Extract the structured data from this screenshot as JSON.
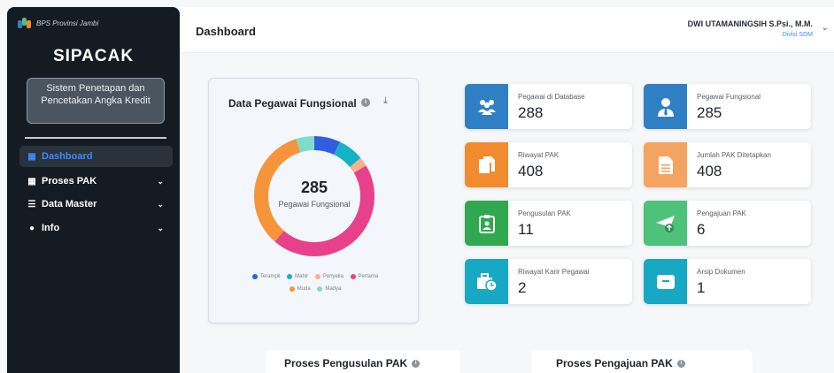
{
  "sidebar": {
    "brand": "BPS Provinsi Jambi",
    "app_title": "SIPACAK",
    "app_subtitle": "Sistem Penetapan dan Pencetakan Angka Kredit",
    "items": [
      {
        "label": "Dashboard",
        "icon": "grid-icon",
        "active": true
      },
      {
        "label": "Proses PAK",
        "icon": "grid-icon",
        "chevron": true
      },
      {
        "label": "Data Master",
        "icon": "database-icon",
        "chevron": true
      },
      {
        "label": "Info",
        "icon": "info-icon",
        "chevron": true
      }
    ]
  },
  "header": {
    "title": "Dashboard",
    "user_name": "DWI UTAMANINGSIH S.Psi., M.M.",
    "user_role": "Divisi SDM"
  },
  "donut_card": {
    "title": "Data Pegawai Fungsional",
    "center_value": "285",
    "center_label": "Pegawai Fungsional",
    "legend": [
      {
        "label": "Terampil",
        "color": "#2f5ee0"
      },
      {
        "label": "Mahir",
        "color": "#15b3c9"
      },
      {
        "label": "Penyelia",
        "color": "#f7b189"
      },
      {
        "label": "Pertama",
        "color": "#e8418c"
      },
      {
        "label": "Muda",
        "color": "#f6943a"
      },
      {
        "label": "Madya",
        "color": "#7fdcc8"
      }
    ]
  },
  "chart_data": {
    "type": "pie",
    "title": "Data Pegawai Fungsional",
    "categories": [
      "Terampil",
      "Mahir",
      "Penyelia",
      "Pertama",
      "Muda",
      "Madya"
    ],
    "values": [
      20,
      20,
      7,
      128,
      96,
      14
    ],
    "colors": [
      "#2f5ee0",
      "#15b3c9",
      "#f7b189",
      "#e8418c",
      "#f6943a",
      "#7fdcc8"
    ],
    "legend_position": "bottom"
  },
  "stats": [
    {
      "label": "Pegawai di Database",
      "value": "288",
      "color": "#2f7fc4",
      "icon": "users-icon"
    },
    {
      "label": "Pegawai Fungsional",
      "value": "285",
      "color": "#2f7fc4",
      "icon": "user-tie-icon"
    },
    {
      "label": "Riwayat PAK",
      "value": "408",
      "color": "#f28a2e",
      "icon": "copy-icon"
    },
    {
      "label": "Jumlah PAK Ditetapkan",
      "value": "408",
      "color": "#f4a460",
      "icon": "file-icon"
    },
    {
      "label": "Pengusulan PAK",
      "value": "11",
      "color": "#2fa84f",
      "icon": "clipboard-user-icon"
    },
    {
      "label": "Pengajuan PAK",
      "value": "6",
      "color": "#4cc27a",
      "icon": "send-icon"
    },
    {
      "label": "Riwayat Karir Pegawai",
      "value": "2",
      "color": "#17a9c4",
      "icon": "briefcase-clock-icon"
    },
    {
      "label": "Arsip Dokumen",
      "value": "1",
      "color": "#17a9c4",
      "icon": "archive-icon"
    }
  ],
  "sections": [
    {
      "title": "Proses Pengusulan PAK"
    },
    {
      "title": "Proses Pengajuan PAK"
    }
  ]
}
